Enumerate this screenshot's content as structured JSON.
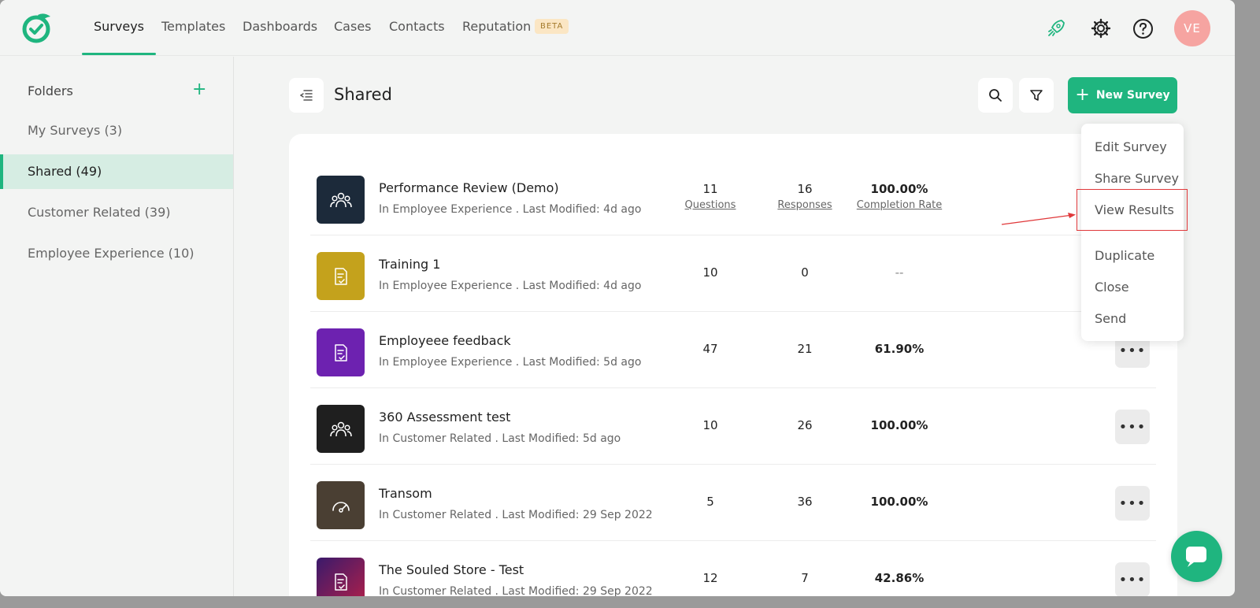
{
  "nav": {
    "items": [
      {
        "label": "Surveys",
        "active": true
      },
      {
        "label": "Templates",
        "active": false
      },
      {
        "label": "Dashboards",
        "active": false
      },
      {
        "label": "Cases",
        "active": false
      },
      {
        "label": "Contacts",
        "active": false
      },
      {
        "label": "Reputation",
        "active": false
      }
    ],
    "beta_badge": "BETA",
    "icons": [
      "rocket-icon",
      "gear-icon",
      "help-icon"
    ],
    "avatar_initials": "VE",
    "accent_color": "#1fb57f"
  },
  "sidebar": {
    "title": "Folders",
    "add_icon": "+",
    "folders": [
      {
        "label": "My Surveys (3)",
        "active": false
      },
      {
        "label": "Shared (49)",
        "active": true
      },
      {
        "label": "Customer Related (39)",
        "active": false
      },
      {
        "label": "Employee Experience (10)",
        "active": false
      }
    ]
  },
  "header": {
    "title": "Shared",
    "new_survey_label": "New Survey"
  },
  "surveys": [
    {
      "title": "Performance Review (Demo)",
      "subtitle": "In Employee Experience . Last Modified: 4d ago",
      "questions": "11",
      "responses": "16",
      "completion": "100.00%",
      "labels": {
        "questions": "Questions",
        "responses": "Responses",
        "completion": "Completion Rate"
      },
      "thumb_color": "#1c2a3a",
      "icon": "people-icon"
    },
    {
      "title": "Training 1",
      "subtitle": "In Employee Experience . Last Modified: 4d ago",
      "questions": "10",
      "responses": "0",
      "completion": "--",
      "thumb_color": "#c4a21c",
      "icon": "document-check-icon"
    },
    {
      "title": "Employeee feedback",
      "subtitle": "In Employee Experience . Last Modified: 5d ago",
      "questions": "47",
      "responses": "21",
      "completion": "61.90%",
      "thumb_color": "#6d22b0",
      "icon": "document-check-icon"
    },
    {
      "title": "360 Assessment test",
      "subtitle": "In Customer Related . Last Modified: 5d ago",
      "questions": "10",
      "responses": "26",
      "completion": "100.00%",
      "thumb_color": "#1f1f1f",
      "icon": "people-icon"
    },
    {
      "title": "Transom",
      "subtitle": "In Customer Related . Last Modified: 29 Sep 2022",
      "questions": "5",
      "responses": "36",
      "completion": "100.00%",
      "thumb_color": "#4a3f33",
      "icon": "gauge-icon"
    },
    {
      "title": "The Souled Store - Test",
      "subtitle": "In Customer Related . Last Modified: 29 Sep 2022",
      "questions": "12",
      "responses": "7",
      "completion": "42.86%",
      "thumb_color": "#8a1f5a",
      "icon": "document-check-icon"
    }
  ],
  "more_label": "•••",
  "dropdown": {
    "items": [
      "Edit Survey",
      "Share Survey",
      "View Results",
      "Duplicate",
      "Close",
      "Send"
    ],
    "highlighted": "View Results"
  }
}
